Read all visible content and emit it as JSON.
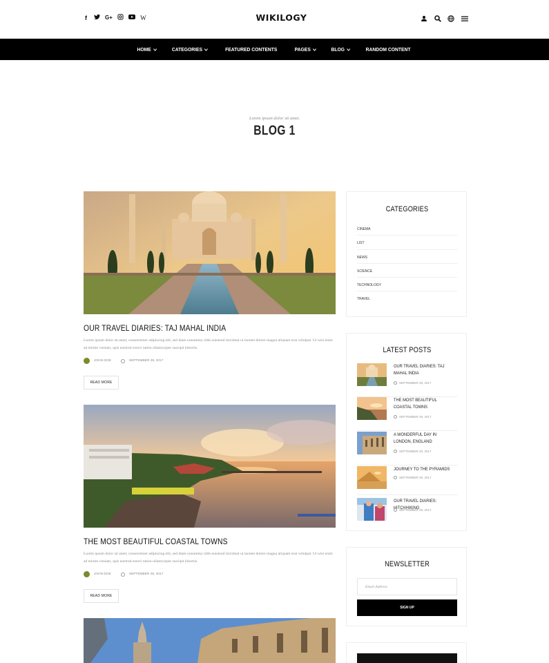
{
  "header": {
    "logo": "WIKILOGY",
    "social_icons": [
      "facebook-icon",
      "twitter-icon",
      "google-plus-icon",
      "instagram-icon",
      "youtube-icon",
      "wikipedia-icon"
    ],
    "social_glyphs": [
      "f",
      "t",
      "G+",
      "◎",
      "▶",
      "W"
    ],
    "right_icons": [
      "user-icon",
      "search-icon",
      "globe-icon",
      "menu-icon"
    ]
  },
  "nav": {
    "items": [
      {
        "label": "HOME",
        "dropdown": true
      },
      {
        "label": "CATEGORIES",
        "dropdown": true
      },
      {
        "label": "FEATURED CONTENTS",
        "dropdown": false
      },
      {
        "label": "PAGES",
        "dropdown": true
      },
      {
        "label": "BLOG",
        "dropdown": true
      },
      {
        "label": "RANDOM CONTENT",
        "dropdown": false
      }
    ]
  },
  "page": {
    "subtitle": "Lorem ipsum dolor sit amet.",
    "title": "BLOG 1"
  },
  "posts": [
    {
      "title": "OUR TRAVEL DIARIES: TAJ MAHAL INDIA",
      "excerpt": "Lorem ipsum dolor sit amet, consectetuer adipiscing elit, sed diam nonummy nibh euismod tincidunt ut laoreet dolore magna aliquam erat volutpat. Ut wisi enim ad minim veniam, quis nostrud exerci tation ullamcorper suscipit lobortis.",
      "author": "JOHN DOE",
      "date": "SEPTEMBER 29, 2017",
      "read_more": "READ MORE",
      "image": "taj-mahal"
    },
    {
      "title": "THE MOST BEAUTIFUL COASTAL TOWNS",
      "excerpt": "Lorem ipsum dolor sit amet, consectetuer adipiscing elit, sed diam nonummy nibh euismod tincidunt ut laoreet dolore magna aliquam erat volutpat. Ut wisi enim ad minim veniam, quis nostrud exerci tation ullamcorper suscipit lobortis.",
      "author": "JOHN DOE",
      "date": "SEPTEMBER 29, 2017",
      "read_more": "READ MORE",
      "image": "coastal-town"
    },
    {
      "image": "london-building"
    }
  ],
  "sidebar": {
    "categories": {
      "title": "CATEGORIES",
      "items": [
        "CINEMA",
        "LIST",
        "NEWS",
        "SCIENCE",
        "TECHNOLOGY",
        "TRAVEL"
      ]
    },
    "latest_posts": {
      "title": "LATEST POSTS",
      "items": [
        {
          "title": "OUR TRAVEL DIARIES: TAJ MAHAL INDIA",
          "date": "SEPTEMBER 29, 2017"
        },
        {
          "title": "THE MOST BEAUTIFUL COASTAL TOWNS",
          "date": "SEPTEMBER 29, 2017"
        },
        {
          "title": "A WONDERFUL DAY IN LONDON, ENGLAND",
          "date": "SEPTEMBER 29, 2017"
        },
        {
          "title": "JOURNEY TO THE PYRAMIDS",
          "date": "SEPTEMBER 29, 2017"
        },
        {
          "title": "OUR TRAVEL DIARIES: HITCHHIKING",
          "date": "SEPTEMBER 29, 2017"
        }
      ]
    },
    "newsletter": {
      "title": "NEWSLETTER",
      "placeholder": "Email Address",
      "button": "SIGN UP"
    }
  }
}
